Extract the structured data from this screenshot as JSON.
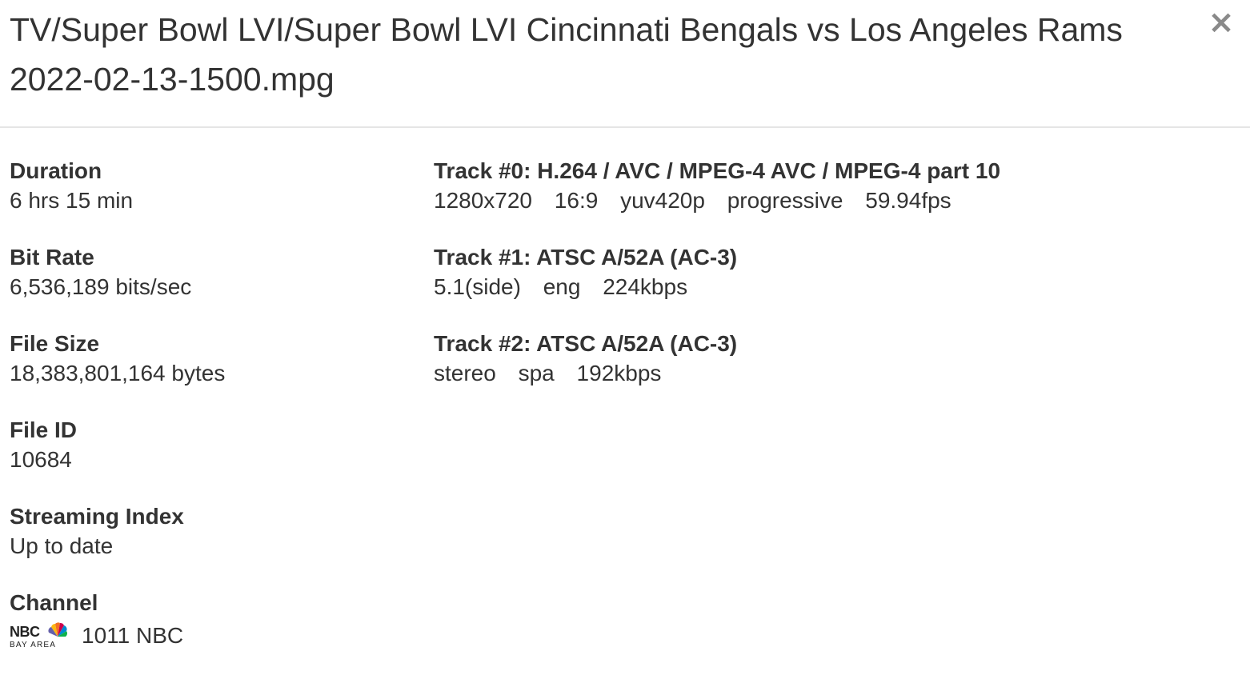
{
  "dialog": {
    "title": "TV/Super Bowl LVI/Super Bowl LVI Cincinnati Bengals vs Los Angeles Rams 2022-02-13-1500.mpg",
    "close_label": "×"
  },
  "fields": {
    "duration": {
      "label": "Duration",
      "value": "6 hrs 15 min"
    },
    "bit_rate": {
      "label": "Bit Rate",
      "value": "6,536,189 bits/sec"
    },
    "file_size": {
      "label": "File Size",
      "value": "18,383,801,164 bytes"
    },
    "file_id": {
      "label": "File ID",
      "value": "10684"
    },
    "streaming_index": {
      "label": "Streaming Index",
      "value": "Up to date"
    },
    "channel": {
      "label": "Channel",
      "value": "1011 NBC",
      "logo": {
        "name": "nbc-bay-area-logo",
        "text_top": "NBC",
        "text_bottom": "BAY AREA"
      }
    }
  },
  "tracks": [
    {
      "heading": "Track #0: H.264 / AVC / MPEG-4 AVC / MPEG-4 part 10",
      "details": [
        "1280x720",
        "16:9",
        "yuv420p",
        "progressive",
        "59.94fps"
      ]
    },
    {
      "heading": "Track #1: ATSC A/52A (AC-3)",
      "details": [
        "5.1(side)",
        "eng",
        "224kbps"
      ]
    },
    {
      "heading": "Track #2: ATSC A/52A (AC-3)",
      "details": [
        "stereo",
        "spa",
        "192kbps"
      ]
    }
  ],
  "colors": {
    "text": "#333333",
    "divider": "#e5e5e5",
    "close_icon": "#8a8a8a"
  }
}
